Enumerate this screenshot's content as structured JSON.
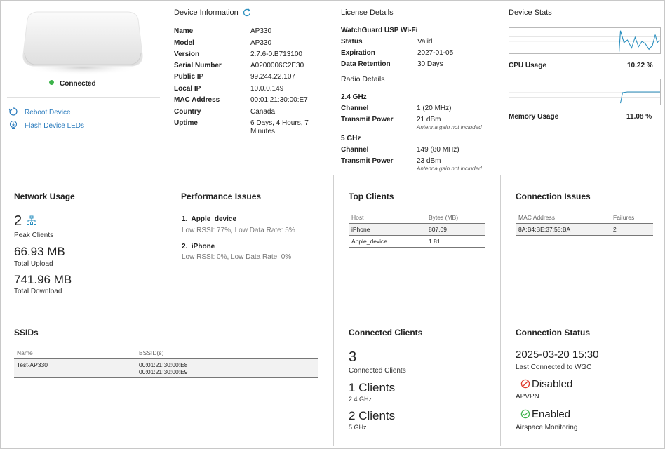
{
  "device": {
    "status": "Connected",
    "actions": [
      {
        "label": "Reboot Device",
        "icon": "reboot-icon"
      },
      {
        "label": "Flash Device LEDs",
        "icon": "flash-led-icon"
      }
    ]
  },
  "device_info": {
    "title": "Device Information",
    "refresh_icon": "refresh-icon",
    "rows": [
      {
        "key": "Name",
        "value": "AP330"
      },
      {
        "key": "Model",
        "value": "AP330"
      },
      {
        "key": "Version",
        "value": "2.7.6-0.B713100"
      },
      {
        "key": "Serial Number",
        "value": "A0200006C2E30"
      },
      {
        "key": "Public IP",
        "value": "99.244.22.107"
      },
      {
        "key": "Local IP",
        "value": "10.0.0.149"
      },
      {
        "key": "MAC Address",
        "value": "00:01:21:30:00:E7"
      },
      {
        "key": "Country",
        "value": "Canada"
      },
      {
        "key": "Uptime",
        "value": "6 Days, 4 Hours, 7",
        "value2": "Minutes"
      }
    ]
  },
  "license": {
    "title": "License Details",
    "product": "WatchGuard USP Wi-Fi",
    "rows": [
      {
        "key": "Status",
        "value": "Valid"
      },
      {
        "key": "Expiration",
        "value": "2027-01-05"
      },
      {
        "key": "Data Retention",
        "value": "30 Days"
      }
    ]
  },
  "radio": {
    "title": "Radio Details",
    "bands": [
      {
        "name": "2.4 GHz",
        "channel_key": "Channel",
        "channel": "1 (20 MHz)",
        "power_key": "Transmit Power",
        "power": "21 dBm",
        "note": "Antenna gain not included"
      },
      {
        "name": "5 GHz",
        "channel_key": "Channel",
        "channel": "149 (80 MHz)",
        "power_key": "Transmit Power",
        "power": "23 dBm",
        "note": "Antenna gain not included"
      }
    ]
  },
  "stats": {
    "title": "Device Stats",
    "cpu_label": "CPU Usage",
    "cpu_value": "10.22 %",
    "memory_label": "Memory Usage",
    "memory_value": "11.08 %",
    "line_color": "#2a8fbf"
  },
  "network_usage": {
    "title": "Network Usage",
    "peak_clients": "2",
    "peak_label": "Peak Clients",
    "upload": "66.93 MB",
    "upload_label": "Total Upload",
    "download": "741.96 MB",
    "download_label": "Total Download"
  },
  "performance": {
    "title": "Performance Issues",
    "items": [
      {
        "num": "1.",
        "name": "Apple_device",
        "detail": "Low RSSI: 77%, Low Data Rate: 5%"
      },
      {
        "num": "2.",
        "name": "iPhone",
        "detail": "Low RSSI: 0%, Low Data Rate: 0%"
      }
    ]
  },
  "top_clients": {
    "title": "Top Clients",
    "headers": [
      "Host",
      "Bytes (MB)"
    ],
    "rows": [
      [
        "iPhone",
        "807.09"
      ],
      [
        "Apple_device",
        "1.81"
      ]
    ]
  },
  "connection_issues": {
    "title": "Connection Issues",
    "headers": [
      "MAC Address",
      "Failures"
    ],
    "rows": [
      [
        "8A:B4:BE:37:55:BA",
        "2"
      ]
    ]
  },
  "ssids": {
    "title": "SSIDs",
    "headers": [
      "Name",
      "BSSID(s)"
    ],
    "rows": [
      {
        "name": "Test-AP330",
        "bssid1": "00:01:21:30:00:E8",
        "bssid2": "00:01:21:30:00:E9"
      }
    ]
  },
  "connected_clients": {
    "title": "Connected Clients",
    "total": "3",
    "total_label": "Connected Clients",
    "band24": "1 Clients",
    "band24_label": "2.4 GHz",
    "band5": "2 Clients",
    "band5_label": "5 GHz"
  },
  "connection_status": {
    "title": "Connection Status",
    "last_connected": "2025-03-20 15:30",
    "last_connected_label": "Last Connected to WGC",
    "apvpn_state": "Disabled",
    "apvpn_label": "APVPN",
    "airspace_state": "Enabled",
    "airspace_label": "Airspace Monitoring",
    "disabled_color": "#e03a2e",
    "enabled_color": "#3cb34a"
  }
}
